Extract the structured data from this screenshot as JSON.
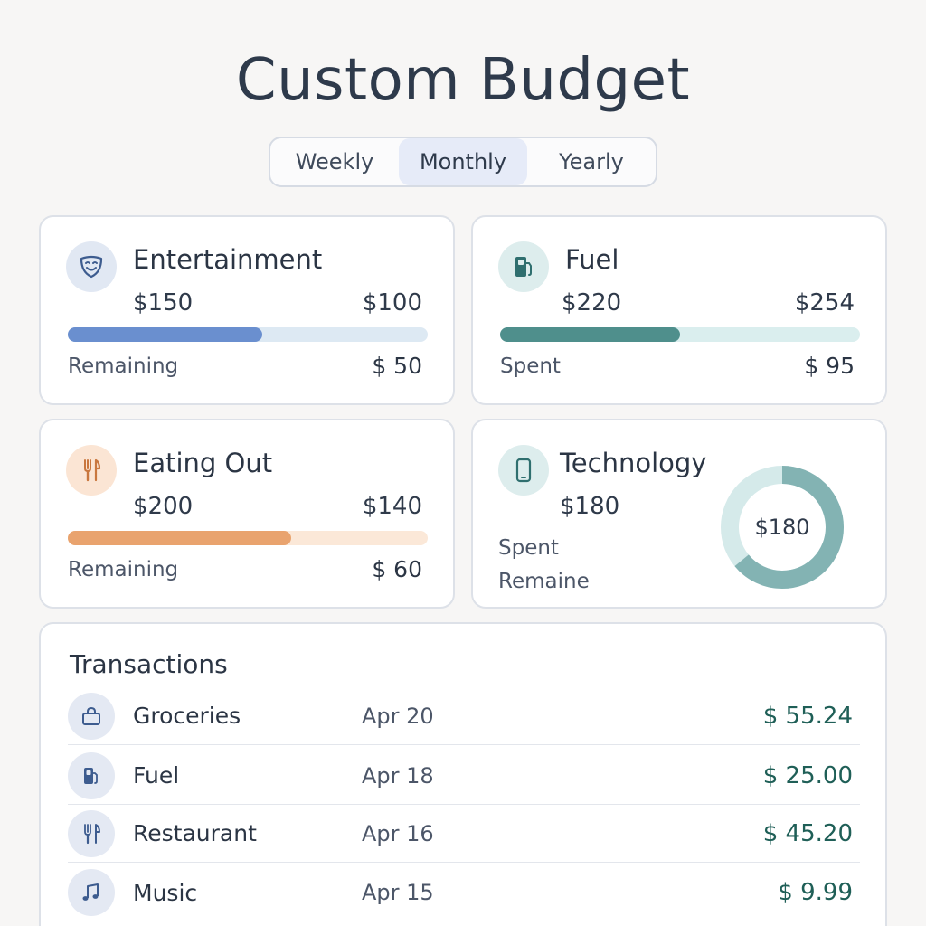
{
  "header": {
    "title": "Custom Budget"
  },
  "period_tabs": [
    {
      "label": "Weekly",
      "active": false
    },
    {
      "label": "Monthly",
      "active": true
    },
    {
      "label": "Yearly",
      "active": false
    }
  ],
  "cards": {
    "entertainment": {
      "title": "Entertainment",
      "budget": "$150",
      "amount": "$100",
      "progress": 0.54,
      "foot_label": "Remaining",
      "foot_value": "$ 50",
      "icon": "theater-mask-icon",
      "color": "#6a8fcf",
      "track": "#dde9f3",
      "icon_bg": "#e1e8f3"
    },
    "fuel": {
      "title": "Fuel",
      "budget": "$220",
      "amount": "$254",
      "progress": 0.5,
      "foot_label": "Spent",
      "foot_value": "$ 95",
      "icon": "fuel-pump-icon",
      "color": "#4f8f8c",
      "track": "#daeeee",
      "icon_bg": "#ddeded"
    },
    "eating_out": {
      "title": "Eating Out",
      "budget": "$200",
      "amount": "$140",
      "progress": 0.62,
      "foot_label": "Remaining",
      "foot_value": "$ 60",
      "icon": "fork-knife-icon",
      "color": "#e9a36e",
      "track": "#fbe8d8",
      "icon_bg": "#fbe5d4"
    },
    "technology": {
      "title": "Technology",
      "budget": "$180",
      "line1": "Spent",
      "line2": "Remaine",
      "donut_value": "$180",
      "donut_fraction": 0.64,
      "icon": "smartphone-icon",
      "color": "#83b3b3",
      "track": "#d5eaea",
      "icon_bg": "#ddeded"
    }
  },
  "transactions": {
    "title": "Transactions",
    "rows": [
      {
        "name": "Groceries",
        "date": "Apr 20",
        "amount": "$ 55.24",
        "icon": "shopping-bag-icon"
      },
      {
        "name": "Fuel",
        "date": "Apr 18",
        "amount": "$ 25.00",
        "icon": "fuel-pump-icon"
      },
      {
        "name": "Restaurant",
        "date": "Apr 16",
        "amount": "$ 45.20",
        "icon": "fork-knife-icon"
      },
      {
        "name": "Music",
        "date": "Apr 15",
        "amount": "$ 9.99",
        "icon": "music-note-icon"
      }
    ]
  }
}
